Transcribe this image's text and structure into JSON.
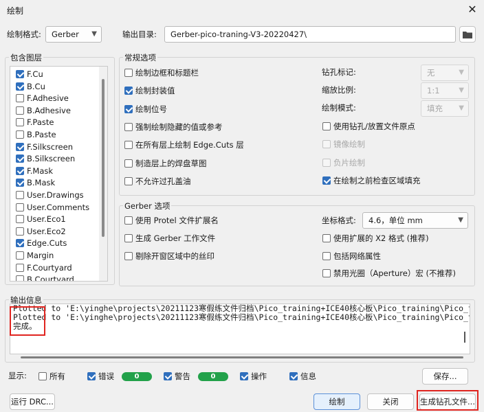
{
  "window": {
    "title": "绘制"
  },
  "top": {
    "format_label": "绘制格式:",
    "format_value": "Gerber",
    "outdir_label": "输出目录:",
    "outdir_value": "Gerber-pico-traning-V3-20220427\\"
  },
  "layers": {
    "title": "包含图层",
    "items": [
      {
        "label": "F.Cu",
        "checked": true
      },
      {
        "label": "B.Cu",
        "checked": true
      },
      {
        "label": "F.Adhesive",
        "checked": false
      },
      {
        "label": "B.Adhesive",
        "checked": false
      },
      {
        "label": "F.Paste",
        "checked": false
      },
      {
        "label": "B.Paste",
        "checked": false
      },
      {
        "label": "F.Silkscreen",
        "checked": true
      },
      {
        "label": "B.Silkscreen",
        "checked": true
      },
      {
        "label": "F.Mask",
        "checked": true
      },
      {
        "label": "B.Mask",
        "checked": true
      },
      {
        "label": "User.Drawings",
        "checked": false
      },
      {
        "label": "User.Comments",
        "checked": false
      },
      {
        "label": "User.Eco1",
        "checked": false
      },
      {
        "label": "User.Eco2",
        "checked": false
      },
      {
        "label": "Edge.Cuts",
        "checked": true
      },
      {
        "label": "Margin",
        "checked": false
      },
      {
        "label": "F.Courtyard",
        "checked": false
      },
      {
        "label": "B.Courtyard",
        "checked": false
      }
    ]
  },
  "general": {
    "title": "常规选项",
    "left": [
      {
        "label": "绘制边框和标题栏",
        "checked": false
      },
      {
        "label": "绘制封装值",
        "checked": true
      },
      {
        "label": "绘制位号",
        "checked": true
      },
      {
        "label": "强制绘制隐藏的值或参考",
        "checked": false
      },
      {
        "label": "在所有层上绘制 Edge.Cuts 层",
        "checked": false
      },
      {
        "label": "制造层上的焊盘草图",
        "checked": false
      },
      {
        "label": "不允许过孔盖油",
        "checked": false
      }
    ],
    "drill_mark_label": "钻孔标记:",
    "drill_mark_value": "无",
    "scale_label": "缩放比例:",
    "scale_value": "1:1",
    "plot_mode_label": "绘制模式:",
    "plot_mode_value": "填充",
    "right": [
      {
        "label": "使用钻孔/放置文件原点",
        "checked": false,
        "disabled": false
      },
      {
        "label": "镜像绘制",
        "checked": false,
        "disabled": true
      },
      {
        "label": "负片绘制",
        "checked": false,
        "disabled": true
      },
      {
        "label": "在绘制之前检查区域填充",
        "checked": true,
        "disabled": false
      }
    ]
  },
  "gerber": {
    "title": "Gerber 选项",
    "left": [
      {
        "label": "使用 Protel 文件扩展名",
        "checked": false
      },
      {
        "label": "生成 Gerber 工作文件",
        "checked": false
      },
      {
        "label": "剔除开窗区域中的丝印",
        "checked": false
      }
    ],
    "coord_label": "坐标格式:",
    "coord_value": "4.6，单位 mm",
    "right": [
      {
        "label": "使用扩展的 X2 格式 (推荐)",
        "checked": false
      },
      {
        "label": "包括网络属性",
        "checked": false
      },
      {
        "label": "禁用光圈（Aperture）宏 (不推荐)",
        "checked": false
      }
    ]
  },
  "output": {
    "title": "输出信息",
    "lines": [
      "Plotted to 'E:\\yinghe\\projects\\20211123寒假练文件归档\\Pico_training+ICE40核心板\\Pico_training\\Pico_tr",
      "Plotted to 'E:\\yinghe\\projects\\20211123寒假练文件归档\\Pico_training+ICE40核心板\\Pico_training\\Pico_tr",
      "完成。"
    ]
  },
  "filters": {
    "show_label": "显示:",
    "all_label": "所有",
    "error_label": "错误",
    "error_count": "0",
    "warning_label": "警告",
    "warning_count": "0",
    "action_label": "操作",
    "info_label": "信息",
    "save_label": "保存..."
  },
  "footer": {
    "drc_label": "运行 DRC...",
    "plot_label": "绘制",
    "close_label": "关闭",
    "drill_label": "生成钻孔文件..."
  },
  "colors": {
    "accent": "#2f6fbd",
    "badge": "#22a14a",
    "highlight": "#e0241f"
  }
}
